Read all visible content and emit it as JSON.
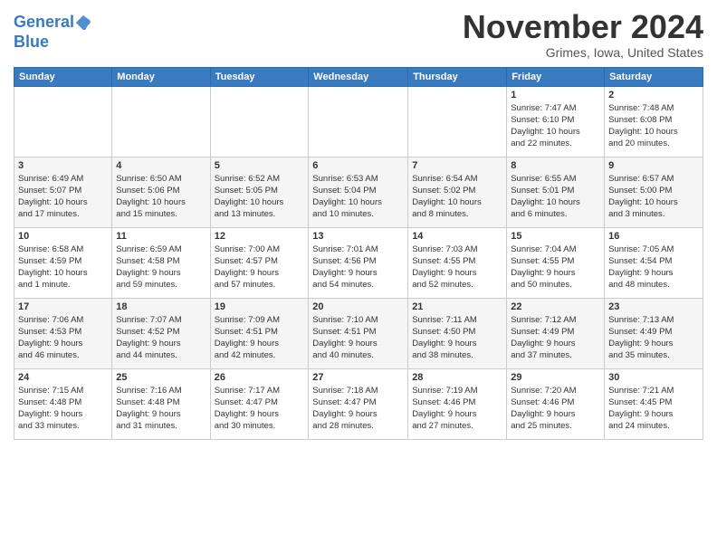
{
  "header": {
    "logo_line1": "General",
    "logo_line2": "Blue",
    "month_title": "November 2024",
    "location": "Grimes, Iowa, United States"
  },
  "days_of_week": [
    "Sunday",
    "Monday",
    "Tuesday",
    "Wednesday",
    "Thursday",
    "Friday",
    "Saturday"
  ],
  "weeks": [
    [
      {
        "day": "",
        "info": ""
      },
      {
        "day": "",
        "info": ""
      },
      {
        "day": "",
        "info": ""
      },
      {
        "day": "",
        "info": ""
      },
      {
        "day": "",
        "info": ""
      },
      {
        "day": "1",
        "info": "Sunrise: 7:47 AM\nSunset: 6:10 PM\nDaylight: 10 hours\nand 22 minutes."
      },
      {
        "day": "2",
        "info": "Sunrise: 7:48 AM\nSunset: 6:08 PM\nDaylight: 10 hours\nand 20 minutes."
      }
    ],
    [
      {
        "day": "3",
        "info": "Sunrise: 6:49 AM\nSunset: 5:07 PM\nDaylight: 10 hours\nand 17 minutes."
      },
      {
        "day": "4",
        "info": "Sunrise: 6:50 AM\nSunset: 5:06 PM\nDaylight: 10 hours\nand 15 minutes."
      },
      {
        "day": "5",
        "info": "Sunrise: 6:52 AM\nSunset: 5:05 PM\nDaylight: 10 hours\nand 13 minutes."
      },
      {
        "day": "6",
        "info": "Sunrise: 6:53 AM\nSunset: 5:04 PM\nDaylight: 10 hours\nand 10 minutes."
      },
      {
        "day": "7",
        "info": "Sunrise: 6:54 AM\nSunset: 5:02 PM\nDaylight: 10 hours\nand 8 minutes."
      },
      {
        "day": "8",
        "info": "Sunrise: 6:55 AM\nSunset: 5:01 PM\nDaylight: 10 hours\nand 6 minutes."
      },
      {
        "day": "9",
        "info": "Sunrise: 6:57 AM\nSunset: 5:00 PM\nDaylight: 10 hours\nand 3 minutes."
      }
    ],
    [
      {
        "day": "10",
        "info": "Sunrise: 6:58 AM\nSunset: 4:59 PM\nDaylight: 10 hours\nand 1 minute."
      },
      {
        "day": "11",
        "info": "Sunrise: 6:59 AM\nSunset: 4:58 PM\nDaylight: 9 hours\nand 59 minutes."
      },
      {
        "day": "12",
        "info": "Sunrise: 7:00 AM\nSunset: 4:57 PM\nDaylight: 9 hours\nand 57 minutes."
      },
      {
        "day": "13",
        "info": "Sunrise: 7:01 AM\nSunset: 4:56 PM\nDaylight: 9 hours\nand 54 minutes."
      },
      {
        "day": "14",
        "info": "Sunrise: 7:03 AM\nSunset: 4:55 PM\nDaylight: 9 hours\nand 52 minutes."
      },
      {
        "day": "15",
        "info": "Sunrise: 7:04 AM\nSunset: 4:55 PM\nDaylight: 9 hours\nand 50 minutes."
      },
      {
        "day": "16",
        "info": "Sunrise: 7:05 AM\nSunset: 4:54 PM\nDaylight: 9 hours\nand 48 minutes."
      }
    ],
    [
      {
        "day": "17",
        "info": "Sunrise: 7:06 AM\nSunset: 4:53 PM\nDaylight: 9 hours\nand 46 minutes."
      },
      {
        "day": "18",
        "info": "Sunrise: 7:07 AM\nSunset: 4:52 PM\nDaylight: 9 hours\nand 44 minutes."
      },
      {
        "day": "19",
        "info": "Sunrise: 7:09 AM\nSunset: 4:51 PM\nDaylight: 9 hours\nand 42 minutes."
      },
      {
        "day": "20",
        "info": "Sunrise: 7:10 AM\nSunset: 4:51 PM\nDaylight: 9 hours\nand 40 minutes."
      },
      {
        "day": "21",
        "info": "Sunrise: 7:11 AM\nSunset: 4:50 PM\nDaylight: 9 hours\nand 38 minutes."
      },
      {
        "day": "22",
        "info": "Sunrise: 7:12 AM\nSunset: 4:49 PM\nDaylight: 9 hours\nand 37 minutes."
      },
      {
        "day": "23",
        "info": "Sunrise: 7:13 AM\nSunset: 4:49 PM\nDaylight: 9 hours\nand 35 minutes."
      }
    ],
    [
      {
        "day": "24",
        "info": "Sunrise: 7:15 AM\nSunset: 4:48 PM\nDaylight: 9 hours\nand 33 minutes."
      },
      {
        "day": "25",
        "info": "Sunrise: 7:16 AM\nSunset: 4:48 PM\nDaylight: 9 hours\nand 31 minutes."
      },
      {
        "day": "26",
        "info": "Sunrise: 7:17 AM\nSunset: 4:47 PM\nDaylight: 9 hours\nand 30 minutes."
      },
      {
        "day": "27",
        "info": "Sunrise: 7:18 AM\nSunset: 4:47 PM\nDaylight: 9 hours\nand 28 minutes."
      },
      {
        "day": "28",
        "info": "Sunrise: 7:19 AM\nSunset: 4:46 PM\nDaylight: 9 hours\nand 27 minutes."
      },
      {
        "day": "29",
        "info": "Sunrise: 7:20 AM\nSunset: 4:46 PM\nDaylight: 9 hours\nand 25 minutes."
      },
      {
        "day": "30",
        "info": "Sunrise: 7:21 AM\nSunset: 4:45 PM\nDaylight: 9 hours\nand 24 minutes."
      }
    ]
  ]
}
